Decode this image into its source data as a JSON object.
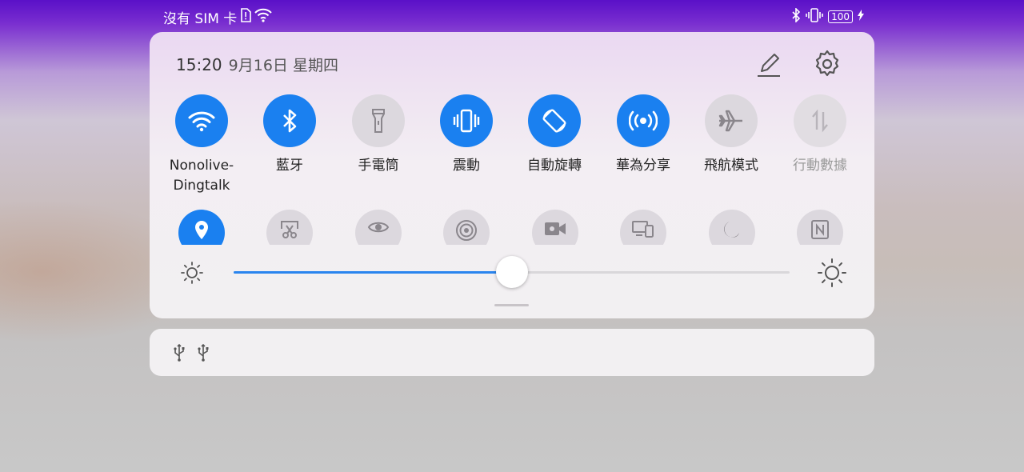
{
  "status_bar": {
    "carrier": "沒有 SIM 卡",
    "battery": "100",
    "icons": [
      "sim-alert-icon",
      "wifi-icon",
      "bluetooth-icon",
      "vibrate-icon",
      "battery-icon",
      "charging-icon"
    ]
  },
  "header": {
    "time": "15:20",
    "date": "9月16日 星期四",
    "edit_icon": "pencil-icon",
    "settings_icon": "gear-icon"
  },
  "toggles": [
    {
      "label": "Nonolive-\nDingtalk",
      "state": "on",
      "icon": "wifi-icon"
    },
    {
      "label": "藍牙",
      "state": "on",
      "icon": "bluetooth-icon"
    },
    {
      "label": "手電筒",
      "state": "off",
      "icon": "flashlight-icon"
    },
    {
      "label": "震動",
      "state": "on",
      "icon": "vibrate-icon"
    },
    {
      "label": "自動旋轉",
      "state": "on",
      "icon": "auto-rotate-icon"
    },
    {
      "label": "華為分享",
      "state": "on",
      "icon": "huawei-share-icon"
    },
    {
      "label": "飛航模式",
      "state": "off",
      "icon": "airplane-icon"
    },
    {
      "label": "行動數據",
      "state": "disabled",
      "icon": "mobile-data-icon"
    }
  ],
  "toggles_row2": [
    {
      "state": "on",
      "icon": "location-icon"
    },
    {
      "state": "off",
      "icon": "screenshot-icon"
    },
    {
      "state": "off",
      "icon": "eye-comfort-icon"
    },
    {
      "state": "off",
      "icon": "hotspot-icon"
    },
    {
      "state": "off",
      "icon": "screen-record-icon"
    },
    {
      "state": "off",
      "icon": "multi-screen-icon"
    },
    {
      "state": "off",
      "icon": "moon-icon"
    },
    {
      "state": "off",
      "icon": "nfc-icon"
    }
  ],
  "brightness": {
    "level": 0.5
  },
  "notifications": {
    "icons": [
      "usb-icon",
      "usb-icon"
    ]
  },
  "colors": {
    "accent": "#1a80f0",
    "inactive": "#dcd8de",
    "statusbar": "#5a10c8"
  }
}
